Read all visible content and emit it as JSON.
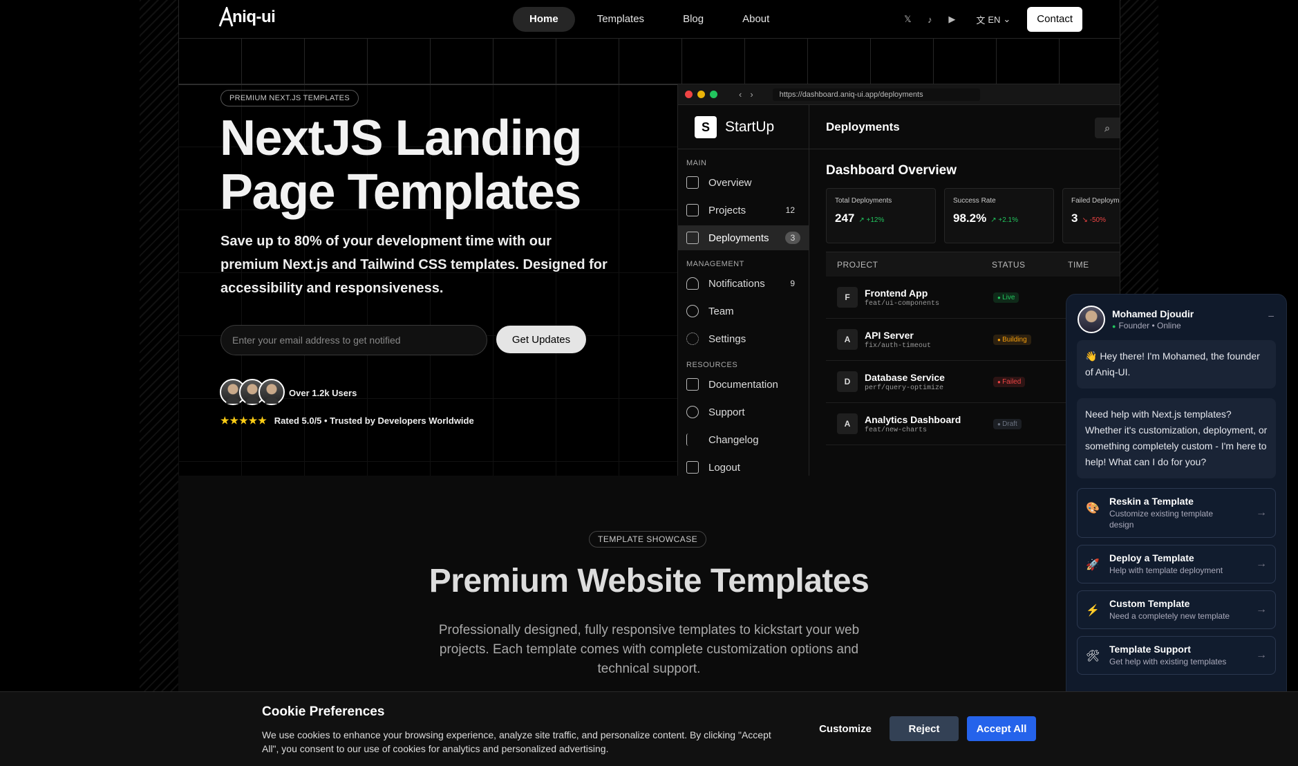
{
  "nav": {
    "logo_text": "niq-ui",
    "logo_letter": "A",
    "menu": [
      "Home",
      "Templates",
      "Blog",
      "About"
    ],
    "social_icons": [
      "x-icon",
      "tiktok-icon",
      "youtube-icon"
    ],
    "lang": "EN",
    "contact": "Contact"
  },
  "hero": {
    "badge": "PREMIUM NEXT.JS TEMPLATES",
    "title": "NextJS Landing Page Templates",
    "subtitle": "Save up to 80% of your development time with our premium Next.js and Tailwind CSS templates. Designed for accessibility and responsiveness.",
    "email_placeholder": "Enter your email address to get notified",
    "cta": "Get Updates",
    "users": "Over 1.2k Users",
    "stars": "★★★★★",
    "rating": "Rated 5.0/5 • Trusted by Developers Worldwide"
  },
  "dashboard": {
    "url": "https://dashboard.aniq-ui.app/deployments",
    "brand_letter": "S",
    "brand": "StartUp",
    "header": "Deployments",
    "sections": {
      "main": "MAIN",
      "management": "MANAGEMENT",
      "resources": "RESOURCES"
    },
    "items": [
      {
        "label": "Overview",
        "count": ""
      },
      {
        "label": "Projects",
        "count": "12"
      },
      {
        "label": "Deployments",
        "count": "3"
      },
      {
        "label": "Notifications",
        "count": "9"
      },
      {
        "label": "Team",
        "count": ""
      },
      {
        "label": "Settings",
        "count": ""
      },
      {
        "label": "Documentation",
        "count": ""
      },
      {
        "label": "Support",
        "count": ""
      },
      {
        "label": "Changelog",
        "count": ""
      },
      {
        "label": "Logout",
        "count": ""
      }
    ],
    "overview_title": "Dashboard Overview",
    "cards": [
      {
        "label": "Total Deployments",
        "value": "247",
        "delta": "↗ +12%"
      },
      {
        "label": "Success Rate",
        "value": "98.2%",
        "delta": "↗ +2.1%"
      },
      {
        "label": "Failed Deployments",
        "value": "3",
        "delta": "↘ -50%"
      }
    ],
    "columns": [
      "PROJECT",
      "STATUS",
      "TIME"
    ],
    "rows": [
      {
        "initial": "F",
        "name": "Frontend App",
        "branch": "feat/ui-components",
        "status": "Live",
        "color": "#22c55e"
      },
      {
        "initial": "A",
        "name": "API Server",
        "branch": "fix/auth-timeout",
        "status": "Building",
        "color": "#f59e0b"
      },
      {
        "initial": "D",
        "name": "Database Service",
        "branch": "perf/query-optimize",
        "status": "Failed",
        "color": "#ef4444"
      },
      {
        "initial": "A",
        "name": "Analytics Dashboard",
        "branch": "feat/new-charts",
        "status": "Draft",
        "color": "#6b7280"
      }
    ]
  },
  "chat": {
    "name": "Mohamed Djoudir",
    "role": "Founder • Online",
    "greeting": "👋 Hey there! I'm Mohamed, the founder of Aniq-UI.",
    "message": "Need help with Next.js templates? Whether it's customization, deployment, or something completely custom - I'm here to help! What can I do for you?",
    "options": [
      {
        "icon": "🎨",
        "title": "Reskin a Template",
        "desc": "Customize existing template design"
      },
      {
        "icon": "🚀",
        "title": "Deploy a Template",
        "desc": "Help with template deployment"
      },
      {
        "icon": "⚡",
        "title": "Custom Template",
        "desc": "Need a completely new template"
      },
      {
        "icon": "🛠",
        "title": "Template Support",
        "desc": "Get help with existing templates"
      }
    ]
  },
  "showcase": {
    "badge": "TEMPLATE SHOWCASE",
    "title": "Premium Website Templates",
    "text": "Professionally designed, fully responsive templates to kickstart your web projects. Each template comes with complete customization options and technical support."
  },
  "cookie": {
    "title": "Cookie Preferences",
    "text": "We use cookies to enhance your browsing experience, analyze site traffic, and personalize content. By clicking \"Accept All\", you consent to our use of cookies for analytics and personalized advertising.",
    "customize": "Customize",
    "reject": "Reject",
    "accept": "Accept All"
  }
}
